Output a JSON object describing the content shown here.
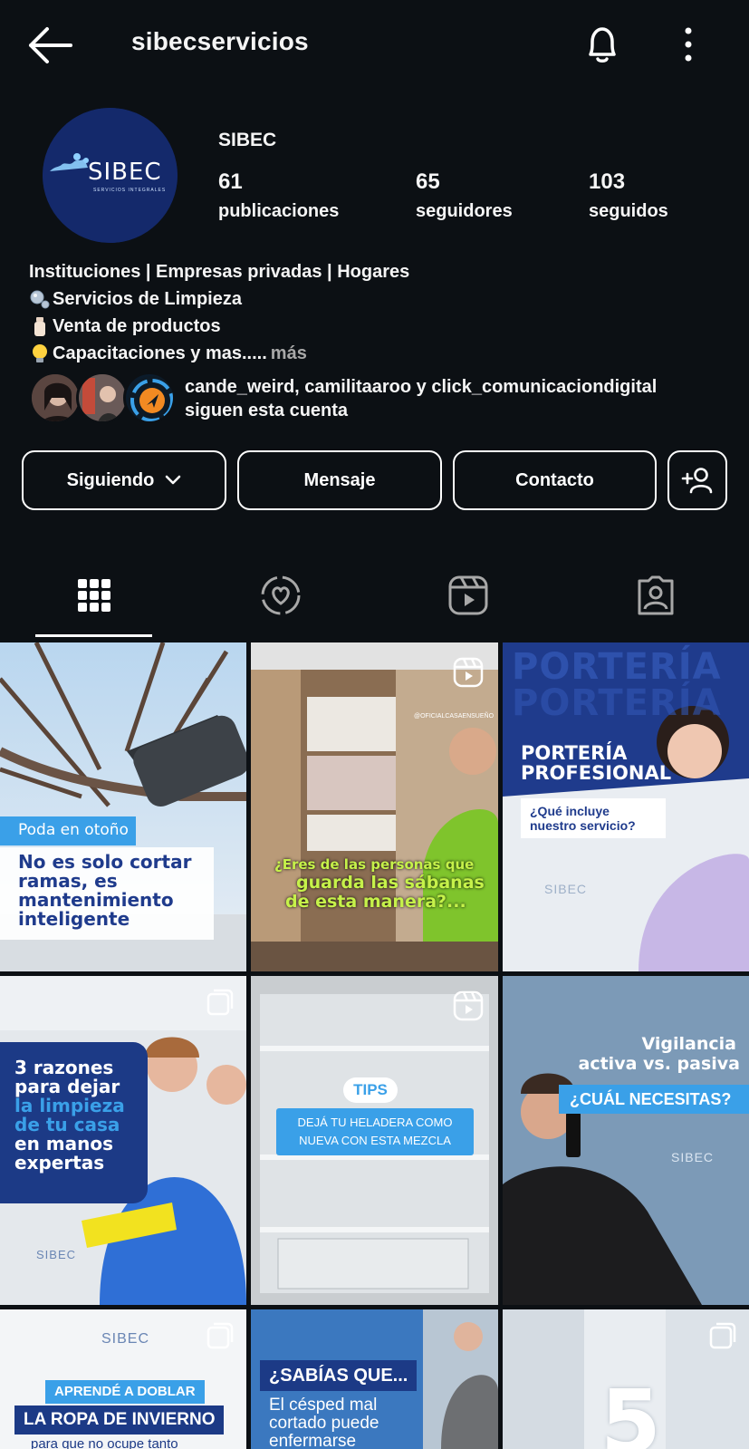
{
  "header": {
    "username": "sibecservicios"
  },
  "profile": {
    "logo_text": "SIBEC",
    "logo_subtext": "SERVICIOS INTEGRALES",
    "display_name": "SIBEC",
    "stats": [
      {
        "value": "61",
        "label": "publicaciones"
      },
      {
        "value": "65",
        "label": "seguidores"
      },
      {
        "value": "103",
        "label": "seguidos"
      }
    ]
  },
  "bio": {
    "line1": "Instituciones | Empresas privadas | Hogares",
    "line2": "Servicios de Limpieza",
    "line3": "Venta de productos",
    "line4": "Capacitaciones y mas.....",
    "more": "más"
  },
  "followed_by": {
    "line1": "cande_weird, camilitaaroo y click_comunicaciondigital",
    "line2": "siguen esta cuenta"
  },
  "buttons": {
    "following": "Siguiendo",
    "message": "Mensaje",
    "contact": "Contacto"
  },
  "posts": [
    {
      "tag": "Poda en otoño",
      "title": "No es solo cortar ramas, es mantenimiento inteligente"
    },
    {
      "watermark": "@OFICIALCASAENSUEÑO",
      "title_line1": "¿Eres de las personas que",
      "title_line2": "guarda las sábanas",
      "title_line3": "de esta manera?..."
    },
    {
      "bg_word": "PORTERÍA",
      "title_line1": "PORTERÍA",
      "title_line2": "PROFESIONAL",
      "tag_line1": "¿Qué incluye",
      "tag_line2": "nuestro servicio?",
      "logo": "SIBEC"
    },
    {
      "title_line1": "3 razones",
      "title_line2": "para dejar",
      "title_line3": "la limpieza",
      "title_line4": "de tu casa",
      "title_line5": "en manos",
      "title_line6": "expertas",
      "logo": "SIBEC"
    },
    {
      "tag": "TIPS",
      "title_line1": "DEJÁ TU HELADERA COMO",
      "title_line2": "NUEVA CON ESTA MEZCLA"
    },
    {
      "title_line1": "Vigilancia",
      "title_line2": "activa vs. pasiva",
      "tag": "¿CUÁL NECESITAS?",
      "logo": "SIBEC"
    },
    {
      "logo": "SIBEC",
      "tag": "APRENDÉ A DOBLAR",
      "title": "LA ROPA DE INVIERNO",
      "sub": "para que no ocupe tanto"
    },
    {
      "tag": "¿SABÍAS QUE...",
      "title_line1": "El césped mal",
      "title_line2": "cortado puede",
      "title_line3": "enfermarse"
    },
    {
      "number": "5"
    }
  ],
  "colors": {
    "background": "#0c1014",
    "brand_blue": "#1f3b8c",
    "accent_light_blue": "#3a9be0",
    "lime": "#c6f24a"
  }
}
